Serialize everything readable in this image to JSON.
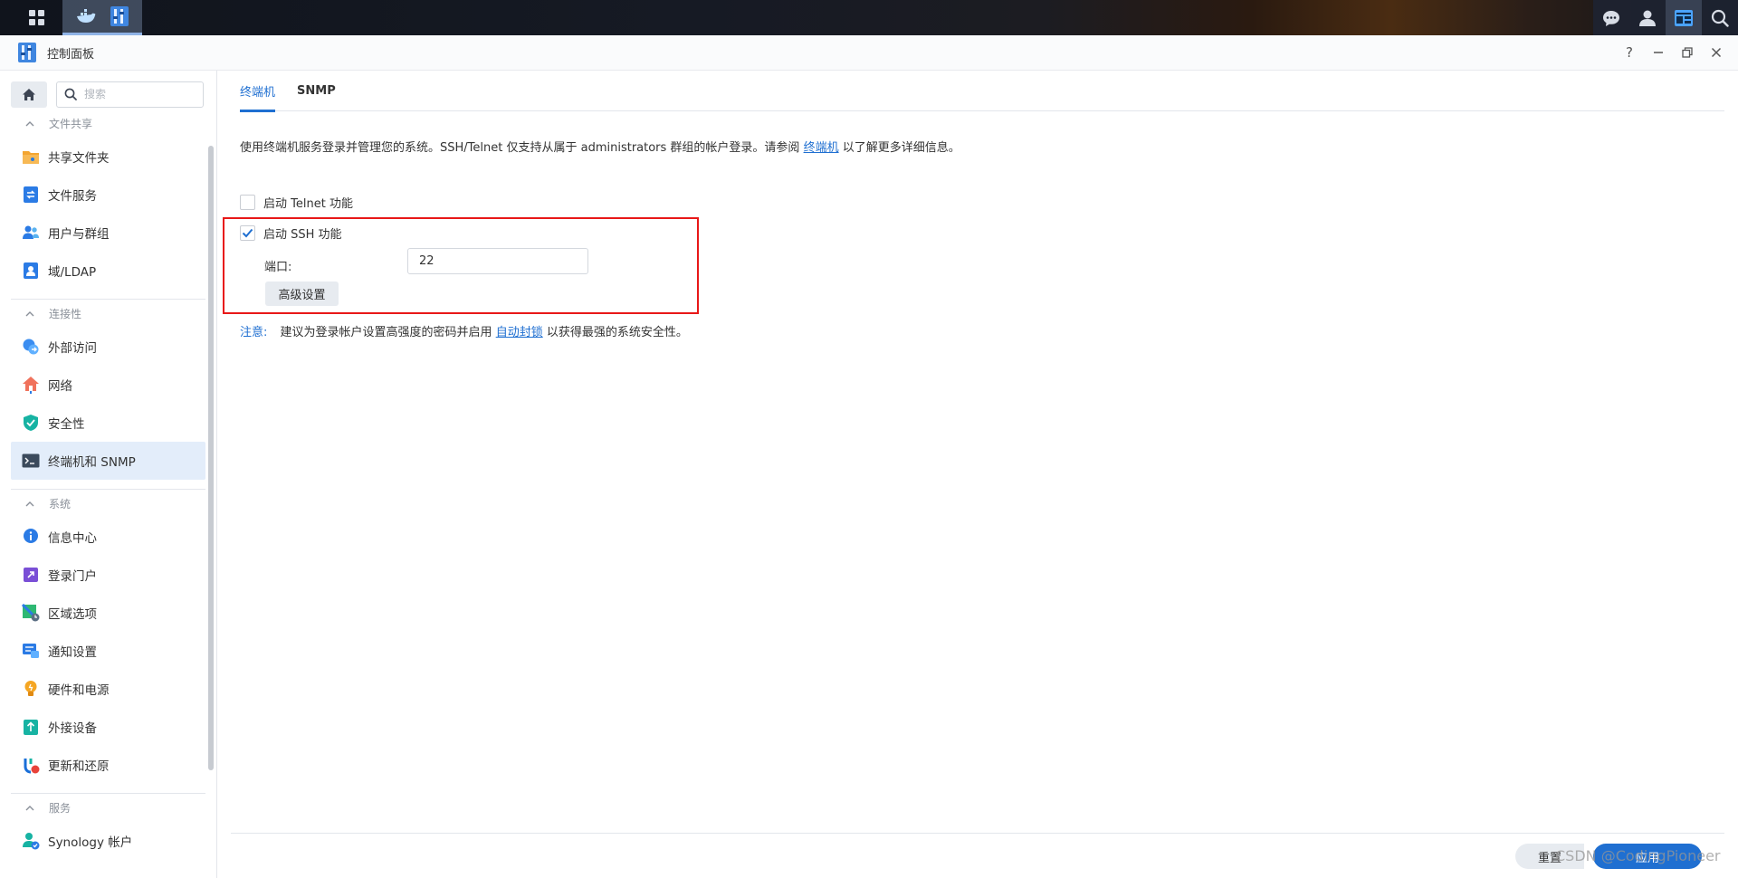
{
  "window": {
    "title": "控制面板"
  },
  "sidebar": {
    "search_placeholder": "搜索",
    "sections": [
      {
        "label": "文件共享"
      },
      {
        "label": "连接性"
      },
      {
        "label": "系统"
      },
      {
        "label": "服务"
      }
    ],
    "items": [
      {
        "label": "共享文件夹"
      },
      {
        "label": "文件服务"
      },
      {
        "label": "用户与群组"
      },
      {
        "label": "域/LDAP"
      },
      {
        "label": "外部访问"
      },
      {
        "label": "网络"
      },
      {
        "label": "安全性"
      },
      {
        "label": "终端机和 SNMP"
      },
      {
        "label": "信息中心"
      },
      {
        "label": "登录门户"
      },
      {
        "label": "区域选项"
      },
      {
        "label": "通知设置"
      },
      {
        "label": "硬件和电源"
      },
      {
        "label": "外接设备"
      },
      {
        "label": "更新和还原"
      },
      {
        "label": "Synology 帐户"
      }
    ]
  },
  "tabs": [
    {
      "label": "终端机"
    },
    {
      "label": "SNMP"
    }
  ],
  "terminal": {
    "description_pre": "使用终端机服务登录并管理您的系统。SSH/Telnet 仅支持从属于 administrators 群组的帐户登录。请参阅",
    "description_link": "终端机",
    "description_post": "以了解更多详细信息。",
    "telnet_label": "启动 Telnet 功能",
    "telnet_checked": false,
    "ssh_label": "启动 SSH 功能",
    "ssh_checked": true,
    "port_label": "端口:",
    "port_value": "22",
    "advanced_label": "高级设置",
    "note_label": "注意:",
    "note_pre": "建议为登录帐户设置高强度的密码并启用",
    "note_link": "自动封锁",
    "note_post": "以获得最强的系统安全性。"
  },
  "footer": {
    "reset_label": "重置",
    "apply_label": "应用"
  },
  "watermark": "CSDN @CodingPioneer",
  "colors": {
    "accent": "#1f6fd1",
    "highlight_border": "#e81818",
    "active_bg": "#e3edfa"
  }
}
